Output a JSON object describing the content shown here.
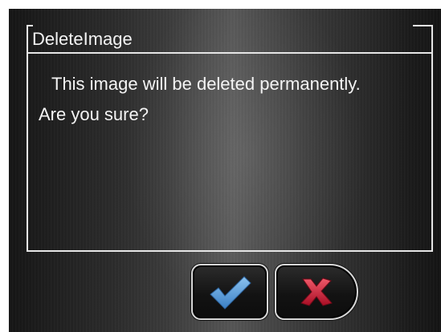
{
  "dialog": {
    "title": "DeleteImage",
    "message_line1": "This image will be deleted permanently.",
    "message_line2": "Are you sure?"
  },
  "buttons": {
    "confirm_icon": "checkmark-icon",
    "cancel_icon": "close-x-icon"
  },
  "colors": {
    "background": "#2e2e2e",
    "frame_line": "#e6e6e6",
    "text": "#f4f4f4",
    "confirm_check": "#4a90d6",
    "cancel_x": "#c8102e"
  }
}
